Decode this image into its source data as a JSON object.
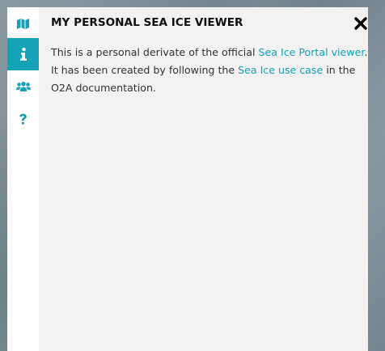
{
  "panel": {
    "title": "MY PERSONAL SEA ICE VIEWER",
    "body": {
      "text_1": "This is a personal derivate of the official ",
      "link_1": "Sea Ice Portal viewer",
      "text_2": ". It has been created by following the ",
      "link_2": "Sea Ice use case",
      "text_3": " in the O2A documentation."
    }
  },
  "sidebar": {
    "tabs": [
      {
        "icon": "map-icon",
        "active": false
      },
      {
        "icon": "info-icon",
        "active": true
      },
      {
        "icon": "users-icon",
        "active": false
      },
      {
        "icon": "question-icon",
        "active": false
      }
    ]
  },
  "colors": {
    "accent": "#13a3b5",
    "panel_background": "#f2f2f2",
    "sidebar_background": "#ffffff",
    "title_text": "#111111",
    "body_text": "#333333"
  }
}
